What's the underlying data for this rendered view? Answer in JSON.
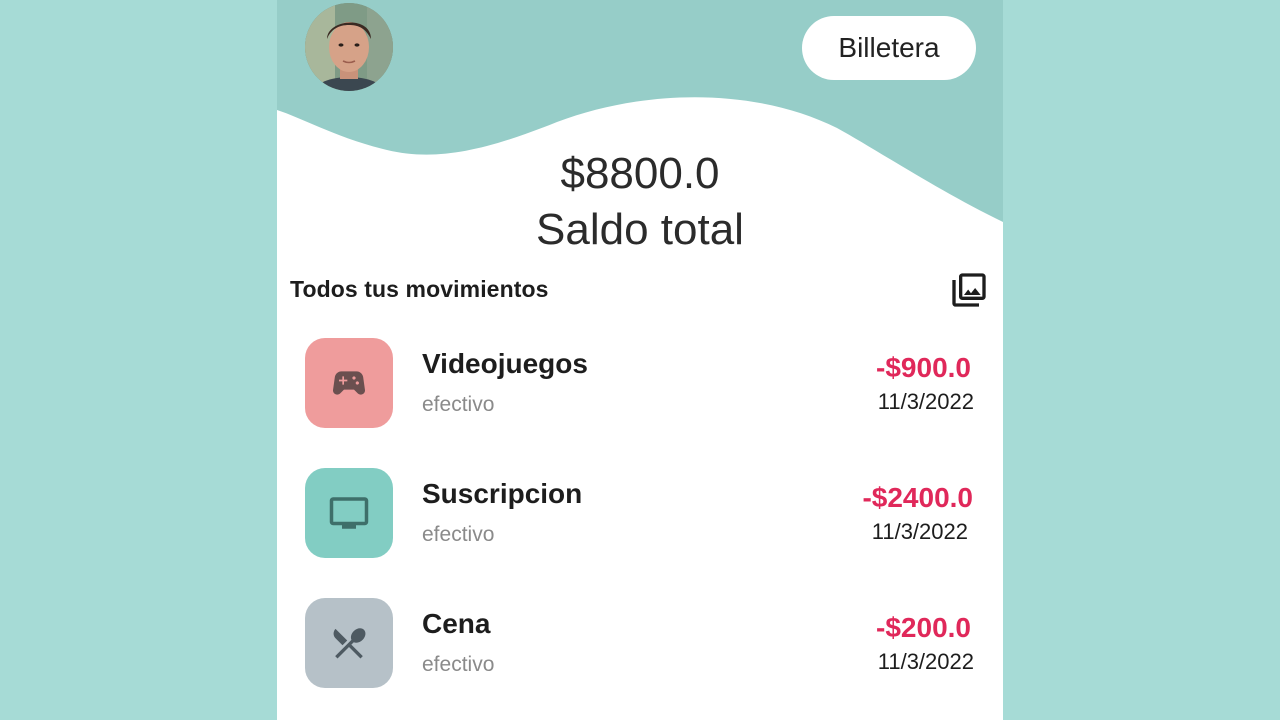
{
  "header": {
    "wallet_button": "Billetera",
    "avatar_icon": "user-avatar-photo",
    "accent_color": "#96cdc8"
  },
  "balance": {
    "amount": "$8800.0",
    "label": "Saldo total"
  },
  "movements": {
    "title": "Todos tus movimientos",
    "action_icon": "photo-library-icon",
    "items": [
      {
        "title": "Videojuegos",
        "method": "efectivo",
        "amount": "-$900.0",
        "date": "11/3/2022",
        "icon": "gamepad-icon",
        "color": "#ef9c9c"
      },
      {
        "title": "Suscripcion",
        "method": "efectivo",
        "amount": "-$2400.0",
        "date": "11/3/2022",
        "icon": "tv-icon",
        "color": "#82cdc3"
      },
      {
        "title": "Cena",
        "method": "efectivo",
        "amount": "-$200.0",
        "date": "11/3/2022",
        "icon": "restaurant-icon",
        "color": "#b6c1c8"
      }
    ]
  }
}
